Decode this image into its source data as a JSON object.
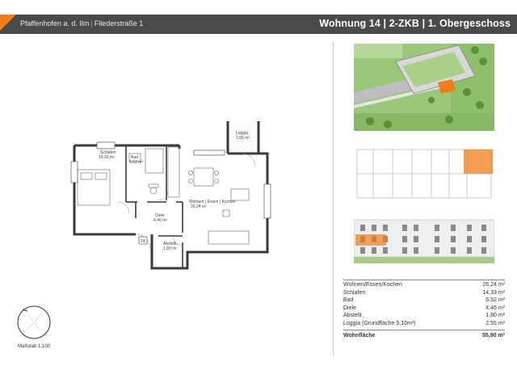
{
  "header": {
    "location": "Pfaffenhofen a. d. Ilm",
    "address": "Fliederstraße 1",
    "apartment_title": "Wohnung 14 | 2-ZKB | 1. Obergeschoss"
  },
  "plan": {
    "unit_number": "14",
    "rooms": [
      {
        "name": "Schlafen",
        "area": "14,33 m²"
      },
      {
        "name": "Bad",
        "area": "6,52 m²"
      },
      {
        "name": "Wohnen | Essen | Kochen",
        "area": "26,24 m²"
      },
      {
        "name": "Diele",
        "area": "4,46 m²"
      },
      {
        "name": "Abstellr.",
        "area": "1,80 m²"
      },
      {
        "name": "Loggia",
        "area": "2,55 m²"
      }
    ]
  },
  "area_table": {
    "rows": [
      {
        "label": "Wohnen/Essen/Kochen",
        "value": "26,24 m²"
      },
      {
        "label": "Schlafen",
        "value": "14,33 m²"
      },
      {
        "label": "Bad",
        "value": "6,52 m²"
      },
      {
        "label": "Diele",
        "value": "4,46 m²"
      },
      {
        "label": "Abstellr.",
        "value": "1,80 m²"
      },
      {
        "label": "Loggia (Grundfläche 5,10m²)",
        "value": "2,55 m²"
      }
    ],
    "total_label": "Wohnfläche",
    "total_value": "55,90 m²"
  },
  "scale": "Maßstab 1:100",
  "colors": {
    "accent": "#f07d1a",
    "header_bg": "#4a4a4a",
    "wall": "#3a3a3a",
    "grass": "#8fbf6a"
  }
}
